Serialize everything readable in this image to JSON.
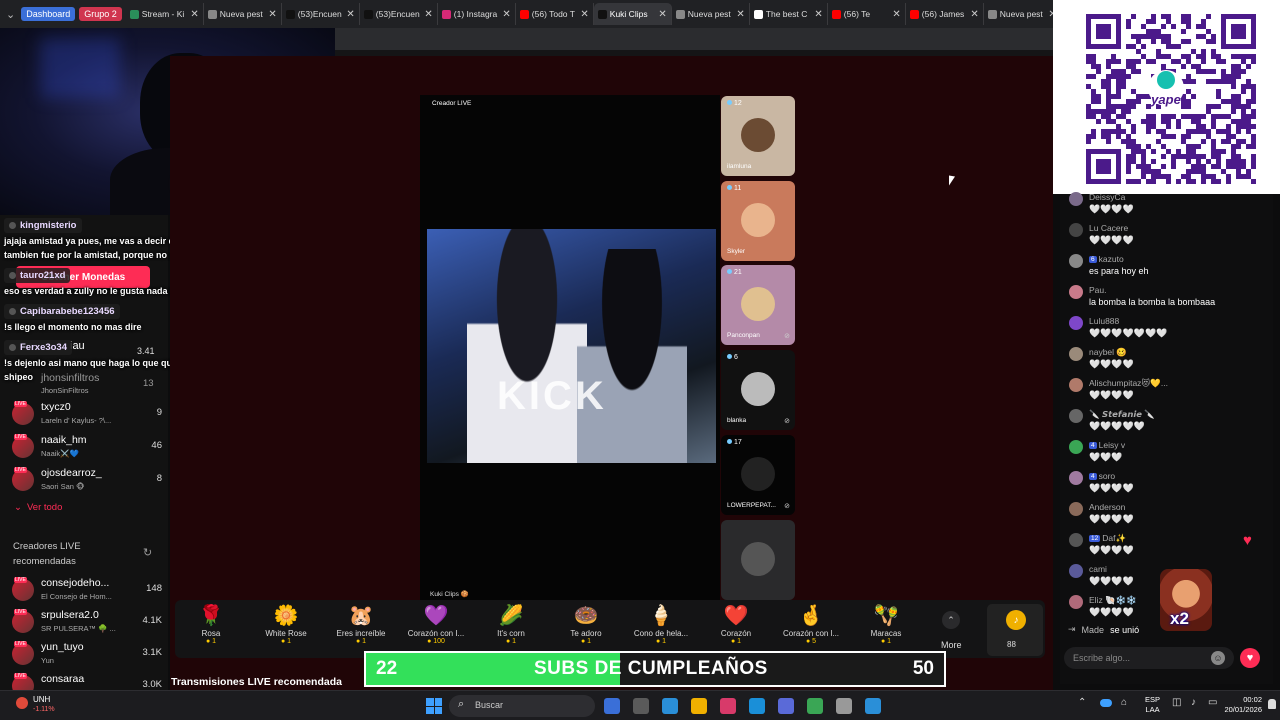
{
  "browser": {
    "groups": [
      {
        "label": "Dashboard",
        "color": "#3b6fd8"
      },
      {
        "label": "Grupo 2",
        "color": "#d0354f"
      }
    ],
    "tabs": [
      {
        "title": "Stream - Ki",
        "favicon_color": "#2a8f5a",
        "active": false
      },
      {
        "title": "Nueva pest",
        "favicon_color": "#888888",
        "active": false
      },
      {
        "title": "(53)Encuen",
        "favicon_color": "#111111",
        "active": false
      },
      {
        "title": "(53)Encuen",
        "favicon_color": "#111111",
        "active": false
      },
      {
        "title": "(1) Instagra",
        "favicon_color": "#d62976",
        "active": false
      },
      {
        "title": "(56) Todo T",
        "favicon_color": "#ff0000",
        "active": false
      },
      {
        "title": "Kuki Clips",
        "favicon_color": "#111111",
        "active": true
      },
      {
        "title": "Nueva pest",
        "favicon_color": "#888888",
        "active": false
      },
      {
        "title": "The best C",
        "favicon_color": "#ffffff",
        "active": false
      },
      {
        "title": "(56) Te",
        "favicon_color": "#ff0000",
        "active": false
      },
      {
        "title": "(56) James",
        "favicon_color": "#ff0000",
        "active": false
      },
      {
        "title": "Nueva pest",
        "favicon_color": "#888888",
        "active": false
      }
    ]
  },
  "left_overlay": {
    "chat": [
      {
        "user": "kingmisterio",
        "lines": [
          "jajaja amistad ya pues, me vas a decir que lo de la bresh cuando le toco la espalda",
          "tambien fue por la amistad, porque no reconocen que tambien zully queria"
        ]
      },
      {
        "user": "tauro21xd",
        "lines": [
          "eso es verdad a zully no le gusta nada apurado porque lo fácil llega fácil seva"
        ]
      },
      {
        "user": "Capibarabebe123456",
        "lines": [
          "!s llego el momento no mas dire"
        ]
      },
      {
        "user": "Ferxe3o34",
        "lines": [
          "!s dejenlo asi mano que haga lo que quiera lo hizo despues de que termino el",
          "shipeo"
        ]
      }
    ],
    "behind_texts": {
      "coins": "Obtener Monedas",
      "count_341": "3.41",
      "name_iau": "iau",
      "name_jhon": "jhonsinfiltros",
      "jhon_sub": "JhonSinFiltros",
      "jhon_count": "13"
    }
  },
  "following": [
    {
      "name": "txycz0",
      "sub": "Lareln d' Kaylus- ?\\...",
      "count": "9"
    },
    {
      "name": "naaik_hm",
      "sub": "Naaik⚔️💙",
      "count": "46"
    },
    {
      "name": "ojosdearroz_",
      "sub": "Saori San 🐵",
      "count": "8"
    }
  ],
  "see_all": "Ver todo",
  "recommended_header": "Creadores LIVE recomendadas",
  "recommended": [
    {
      "name": "consejodeho...",
      "sub": "El Consejo de Hom...",
      "count": "148"
    },
    {
      "name": "srpulsera2.0",
      "sub": "SR PULSERA™ 🌳 ...",
      "count": "4.1K"
    },
    {
      "name": "yun_tuyo",
      "sub": "Yun",
      "count": "3.1K"
    },
    {
      "name": "consaraa",
      "sub": "",
      "count": "3.0K"
    }
  ],
  "live": {
    "creator_label": "Creador LIVE",
    "footer_label": "Kuki Clips 🍪",
    "video_watermark": "KICK",
    "recommended_title": "Transmisiones LIVE recomendada"
  },
  "guests": [
    {
      "name": "ilamluna",
      "viewers": "12",
      "bg": "#c9b7a3",
      "av": "#6b4b33"
    },
    {
      "name": "Skyler",
      "viewers": "11",
      "bg": "#c97a5c",
      "av": "#e9b48d"
    },
    {
      "name": "Panconpan",
      "viewers": "21",
      "bg": "#b48aa8",
      "av": "#e0c090"
    },
    {
      "name": "blanka",
      "viewers": "6",
      "bg": "#111111",
      "av": "#bbbbbb"
    },
    {
      "name": "LOWERPEPAT...",
      "viewers": "17",
      "bg": "#050505",
      "av": "#222222"
    },
    {
      "name": "",
      "viewers": "",
      "bg": "#2a2a2c",
      "av": "#555555"
    }
  ],
  "gifts": [
    {
      "icon": "🌹",
      "label": "Rosa",
      "price": "1"
    },
    {
      "icon": "🌼",
      "label": "White Rose",
      "price": "1"
    },
    {
      "icon": "🐹",
      "label": "Eres increíble",
      "price": "1"
    },
    {
      "icon": "💜",
      "label": "Corazón con I...",
      "price": "100"
    },
    {
      "icon": "🌽",
      "label": "It's corn",
      "price": "1"
    },
    {
      "icon": "🍩",
      "label": "Te adoro",
      "price": "1"
    },
    {
      "icon": "🍦",
      "label": "Cono de hela...",
      "price": "1"
    },
    {
      "icon": "❤️",
      "label": "Corazón",
      "price": "1"
    },
    {
      "icon": "🤞",
      "label": "Corazón con l...",
      "price": "5"
    },
    {
      "icon": "🪇",
      "label": "Maracas",
      "price": "1"
    }
  ],
  "gift_more": "More",
  "coins_balance": "88",
  "subs_banner": {
    "current": "22",
    "title": "SUBS DE CUMPLEAÑOS",
    "goal": "50",
    "progress": 0.44
  },
  "right_chat": [
    {
      "name": "DeissyCa",
      "msg": "🤍🤍🤍🤍",
      "badge": "",
      "av": "#7a6a8a"
    },
    {
      "name": "Lu Cacere",
      "msg": "🤍🤍🤍🤍",
      "badge": "",
      "av": "#444444"
    },
    {
      "name": "kazuto",
      "msg": "es para hoy eh",
      "badge": "6",
      "av": "#888888"
    },
    {
      "name": "Pau.",
      "msg": "la bomba la bomba la bombaaa",
      "badge": "",
      "av": "#c87a8a"
    },
    {
      "name": "Lulu888",
      "msg": "🤍🤍🤍🤍🤍🤍🤍",
      "badge": "",
      "av": "#7e47c9"
    },
    {
      "name": "naybel 🥴",
      "msg": "🤍🤍🤍🤍",
      "badge": "",
      "av": "#9a8a7a"
    },
    {
      "name": "Alischumpitaz😻💛...",
      "msg": "🤍🤍🤍🤍",
      "badge": "",
      "av": "#b07a6a"
    },
    {
      "name": "🔪 𝙎𝙩𝙚𝙛𝙖𝙣𝙞𝙚 🔪",
      "msg": "🤍🤍🤍🤍🤍",
      "badge": "",
      "av": "#666666"
    },
    {
      "name": "Leisy v",
      "msg": "🤍🤍🤍",
      "badge": "4",
      "av": "#3aa655"
    },
    {
      "name": "soro",
      "msg": "🤍🤍🤍🤍",
      "badge": "4",
      "av": "#a07aa0"
    },
    {
      "name": "Anderson",
      "msg": "🤍🤍🤍🤍",
      "badge": "",
      "av": "#8a6a5a"
    },
    {
      "name": "Daf✨",
      "msg": "🤍🤍🤍🤍",
      "badge": "12",
      "av": "#555555"
    },
    {
      "name": "cami",
      "msg": "🤍🤍🤍🤍",
      "badge": "",
      "av": "#5a5a9a"
    },
    {
      "name": "Eliz 🐚❄️❄️",
      "msg": "🤍🤍🤍🤍",
      "badge": "",
      "av": "#b06a7a"
    }
  ],
  "joined": {
    "name": "Made",
    "text": "se unió"
  },
  "chat_input_placeholder": "Escribe algo...",
  "gift_multiplier": "x2",
  "taskbar": {
    "weather_temp": "UNH",
    "weather_change": "-1.11%",
    "search_placeholder": "Buscar",
    "lang": "ESP",
    "lang_sub": "LAA",
    "time": "00:02",
    "date": "20/01/2026"
  }
}
